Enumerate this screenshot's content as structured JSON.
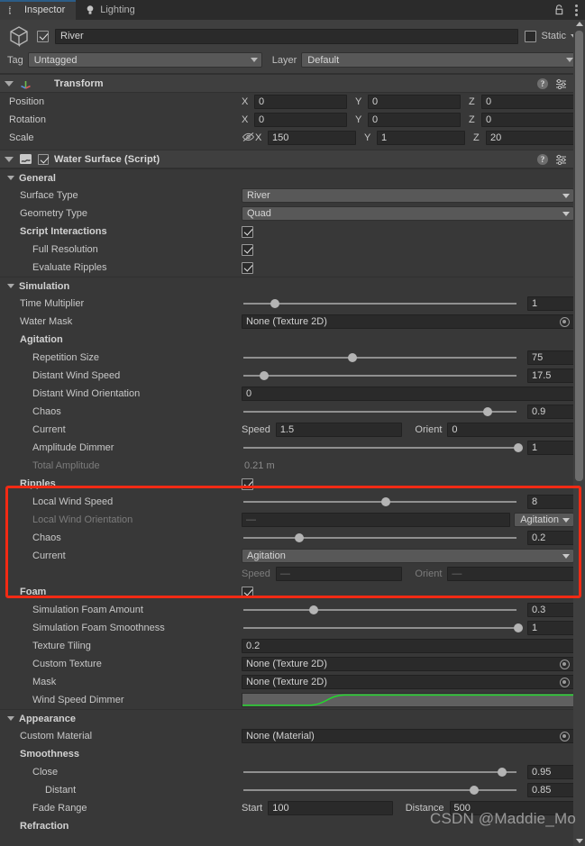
{
  "window": {
    "tabs": [
      {
        "label": "Inspector",
        "icon": "info-icon",
        "active": true
      },
      {
        "label": "Lighting",
        "icon": "bulb-icon",
        "active": false
      }
    ],
    "lock_icon": "lock-icon",
    "menu_icon": "kebab-menu-icon"
  },
  "object_header": {
    "icon": "gameobject-cube-icon",
    "enabled": true,
    "name": "River",
    "static_label": "Static",
    "static_checked": false,
    "tag_label": "Tag",
    "tag_value": "Untagged",
    "layer_label": "Layer",
    "layer_value": "Default"
  },
  "transform": {
    "title": "Transform",
    "icon": "transform-axis-icon",
    "help_icon": "help-icon",
    "preset_icon": "preset-icon",
    "menu_icon": "kebab-menu-icon",
    "axes": [
      "X",
      "Y",
      "Z"
    ],
    "rows": [
      {
        "label": "Position",
        "values": [
          "0",
          "0",
          "0"
        ],
        "eye": false
      },
      {
        "label": "Rotation",
        "values": [
          "0",
          "0",
          "0"
        ],
        "eye": false
      },
      {
        "label": "Scale",
        "values": [
          "150",
          "1",
          "20"
        ],
        "eye": true,
        "eye_icon": "eye-off-icon"
      }
    ]
  },
  "water_surface": {
    "title": "Water Surface (Script)",
    "icon": "script-icon",
    "enabled": true,
    "help_icon": "help-icon",
    "preset_icon": "preset-icon",
    "menu_icon": "kebab-menu-icon",
    "sections": {
      "general": {
        "title": "General",
        "surface_type": {
          "label": "Surface Type",
          "value": "River"
        },
        "geometry_type": {
          "label": "Geometry Type",
          "value": "Quad"
        },
        "script_interactions": {
          "label": "Script Interactions",
          "checked": true
        },
        "full_resolution": {
          "label": "Full Resolution",
          "checked": true
        },
        "evaluate_ripples": {
          "label": "Evaluate Ripples",
          "checked": true
        }
      },
      "simulation": {
        "title": "Simulation",
        "time_multiplier": {
          "label": "Time Multiplier",
          "value": "1",
          "knob_pct": 12
        },
        "water_mask": {
          "label": "Water Mask",
          "value": "None (Texture 2D)"
        },
        "agitation": {
          "title": "Agitation",
          "repetition_size": {
            "label": "Repetition Size",
            "value": "75",
            "knob_pct": 40
          },
          "distant_wind_speed": {
            "label": "Distant Wind Speed",
            "value": "17.5",
            "knob_pct": 8
          },
          "distant_wind_orientation": {
            "label": "Distant Wind Orientation",
            "value": "0"
          },
          "chaos": {
            "label": "Chaos",
            "value": "0.9",
            "knob_pct": 89
          },
          "current": {
            "label": "Current",
            "speed_label": "Speed",
            "speed_value": "1.5",
            "orient_label": "Orient",
            "orient_value": "0"
          },
          "amplitude_dimmer": {
            "label": "Amplitude Dimmer",
            "value": "1",
            "knob_pct": 100
          },
          "total_amplitude": {
            "label": "Total Amplitude",
            "value": "0.21 m"
          }
        },
        "ripples": {
          "title": "Ripples",
          "checked": true,
          "highlighted": true,
          "local_wind_speed": {
            "label": "Local Wind Speed",
            "value": "8",
            "knob_pct": 52
          },
          "local_wind_orientation": {
            "label": "Local Wind Orientation",
            "value": "—",
            "mode": "Agitation",
            "disabled": true
          },
          "chaos": {
            "label": "Chaos",
            "value": "0.2",
            "knob_pct": 21
          },
          "current": {
            "label": "Current",
            "mode": "Agitation",
            "speed_label": "Speed",
            "speed_value": "—",
            "orient_label": "Orient",
            "orient_value": "—",
            "disabled": true
          }
        },
        "foam": {
          "title": "Foam",
          "checked": true,
          "simulation_foam_amount": {
            "label": "Simulation Foam Amount",
            "value": "0.3",
            "knob_pct": 26
          },
          "simulation_foam_smoothness": {
            "label": "Simulation Foam Smoothness",
            "value": "1",
            "knob_pct": 100
          },
          "texture_tiling": {
            "label": "Texture Tiling",
            "value": "0.2"
          },
          "custom_texture": {
            "label": "Custom Texture",
            "value": "None (Texture 2D)"
          },
          "mask": {
            "label": "Mask",
            "value": "None (Texture 2D)"
          },
          "wind_speed_dimmer": {
            "label": "Wind Speed Dimmer",
            "curve_color": "#1fdd2a"
          }
        }
      },
      "appearance": {
        "title": "Appearance",
        "custom_material": {
          "label": "Custom Material",
          "value": "None (Material)"
        },
        "smoothness": {
          "title": "Smoothness",
          "close": {
            "label": "Close",
            "value": "0.95",
            "knob_pct": 94
          },
          "distant": {
            "label": "Distant",
            "value": "0.85",
            "knob_pct": 84
          }
        },
        "fade_range": {
          "label": "Fade Range",
          "start_label": "Start",
          "start_value": "100",
          "distance_label": "Distance",
          "distance_value": "500"
        },
        "refraction": {
          "title": "Refraction"
        }
      }
    }
  },
  "watermark": "CSDN @Maddie_Mo",
  "colors": {
    "accent_tab": "#2c5d87",
    "highlight_box": "#f22a14",
    "curve_green": "#1fdd2a",
    "panel_bg": "#383838",
    "header_bg": "#3f3f3f"
  }
}
